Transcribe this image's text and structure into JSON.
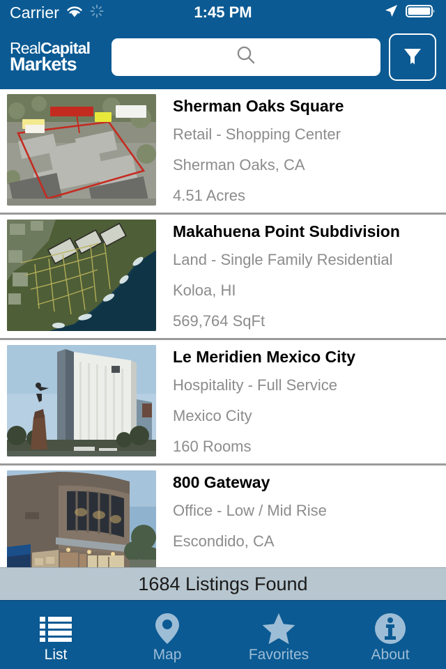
{
  "status_bar": {
    "carrier": "Carrier",
    "time": "1:45 PM",
    "wifi_icon": "wifi-icon",
    "activity_icon": "activity-spinner-icon",
    "location_icon": "location-arrow-icon",
    "battery_icon": "battery-icon"
  },
  "header": {
    "logo_line1_thin": "Real",
    "logo_line1_bold": "Capital",
    "logo_line2": "Markets",
    "search_placeholder": "",
    "search_value": "",
    "search_icon": "search-icon",
    "filter_icon": "filter-funnel-icon"
  },
  "listings": [
    {
      "title": "Sherman Oaks Square",
      "type": "Retail - Shopping Center",
      "location": "Sherman Oaks, CA",
      "size": "4.51 Acres",
      "thumbnail": "aerial-photo-shopping-center"
    },
    {
      "title": "Makahuena Point Subdivision",
      "type": "Land - Single Family Residential",
      "location": "Koloa, HI",
      "size": "569,764 SqFt",
      "thumbnail": "satellite-photo-coastal-land"
    },
    {
      "title": "Le Meridien Mexico City",
      "type": "Hospitality - Full Service",
      "location": "Mexico City",
      "size": "160 Rooms",
      "thumbnail": "photo-glass-hotel-tower"
    },
    {
      "title": "800 Gateway",
      "type": "Office - Low / Mid Rise",
      "location": "Escondido, CA",
      "size": "",
      "thumbnail": "photo-office-building-dusk"
    }
  ],
  "count_bar": {
    "text": "1684 Listings Found"
  },
  "tabs": [
    {
      "label": "List",
      "icon": "list-icon",
      "active": true
    },
    {
      "label": "Map",
      "icon": "map-pin-icon",
      "active": false
    },
    {
      "label": "Favorites",
      "icon": "star-icon",
      "active": false
    },
    {
      "label": "About",
      "icon": "info-circle-icon",
      "active": false
    }
  ],
  "colors": {
    "brand_blue": "#0b5a93",
    "count_bar_bg": "#b7c6cf",
    "inactive_tab": "#9dbdd6",
    "detail_text": "#8c8c8c"
  }
}
